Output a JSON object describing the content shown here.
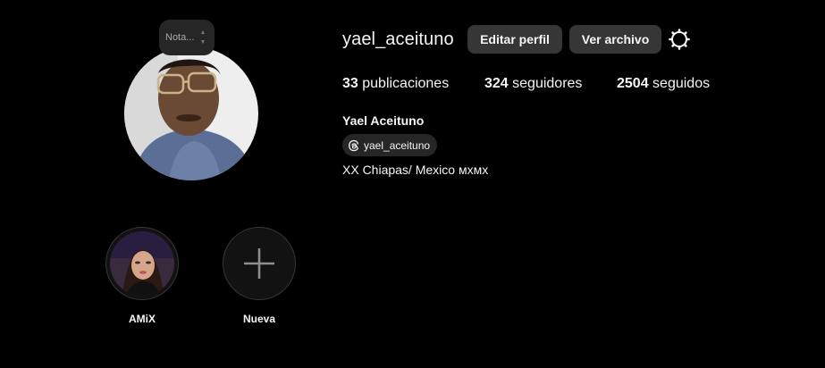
{
  "profile": {
    "username": "yael_aceituno",
    "full_name": "Yael Aceituno",
    "threads_handle": "yael_aceituno",
    "bio": "XX Chiapas/ Mexico мхмх",
    "note_placeholder": "Nota..."
  },
  "actions": {
    "edit_profile": "Editar perfil",
    "view_archive": "Ver archivo"
  },
  "stats": {
    "posts_count": "33",
    "posts_label": "publicaciones",
    "followers_count": "324",
    "followers_label": "seguidores",
    "following_count": "2504",
    "following_label": "seguidos"
  },
  "highlights": [
    {
      "label": "AMiX"
    },
    {
      "label": "Nueva"
    }
  ],
  "colors": {
    "background": "#000000",
    "button": "#363636",
    "pill": "#262626",
    "text": "#f5f5f5"
  },
  "icons": {
    "settings": "gear-icon",
    "threads": "threads-icon",
    "new_highlight": "plus-icon"
  }
}
